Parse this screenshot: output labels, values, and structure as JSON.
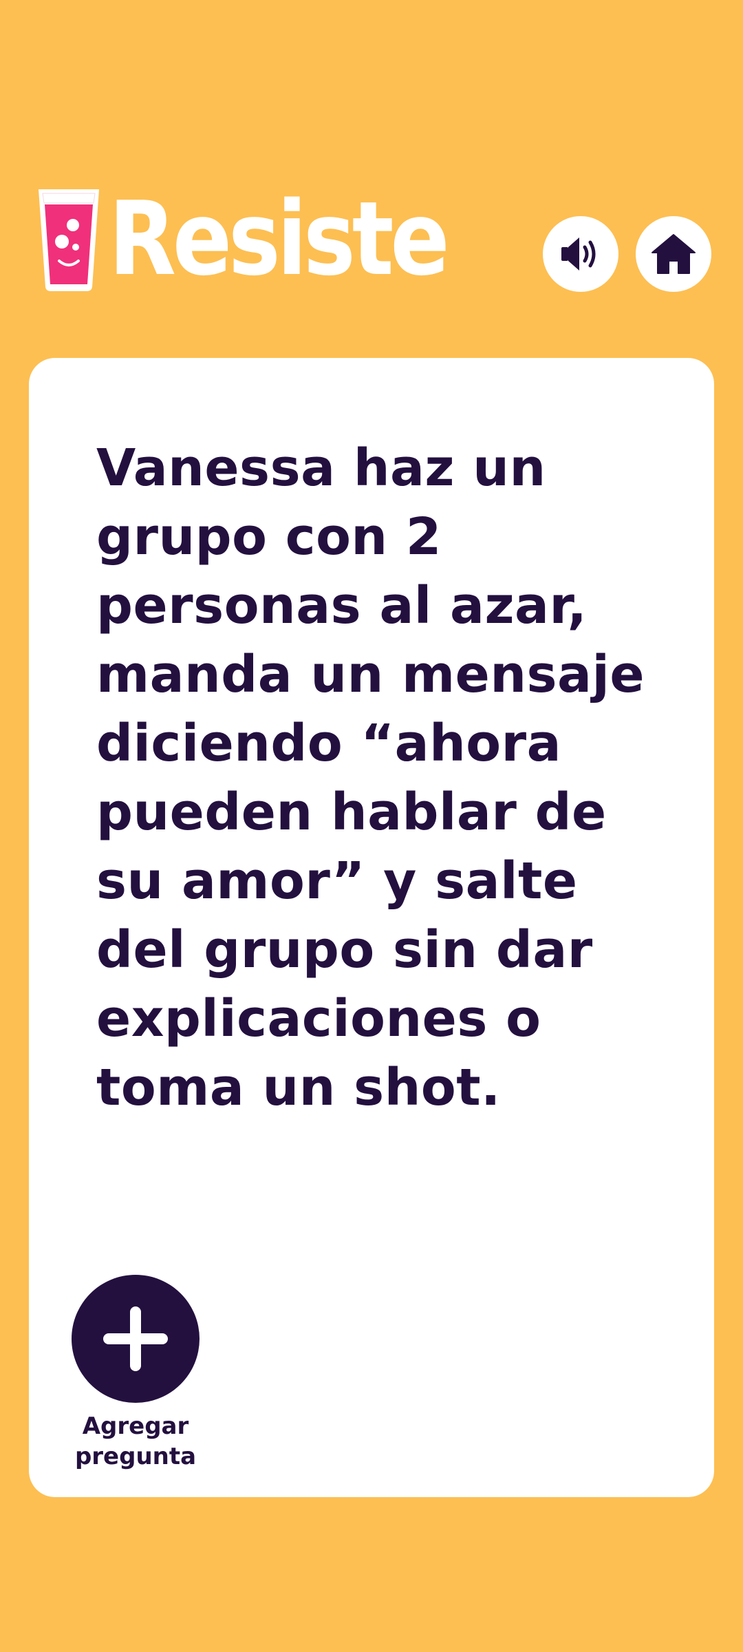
{
  "header": {
    "app_name": "Resiste",
    "logo_icon": "drink-glass-icon",
    "sound_icon": "speaker-icon",
    "home_icon": "home-icon"
  },
  "card": {
    "question": "Vanessa haz un grupo con 2 personas al azar, manda un mensaje diciendo “ahora pueden hablar de su amor” y salte del grupo sin dar explicaciones o toma un shot.",
    "add_icon": "plus-icon",
    "add_label": "Agregar pregunta"
  },
  "colors": {
    "background": "#FDBF52",
    "card": "#FFFFFF",
    "text": "#23103F",
    "accent_pink": "#F0307A"
  }
}
